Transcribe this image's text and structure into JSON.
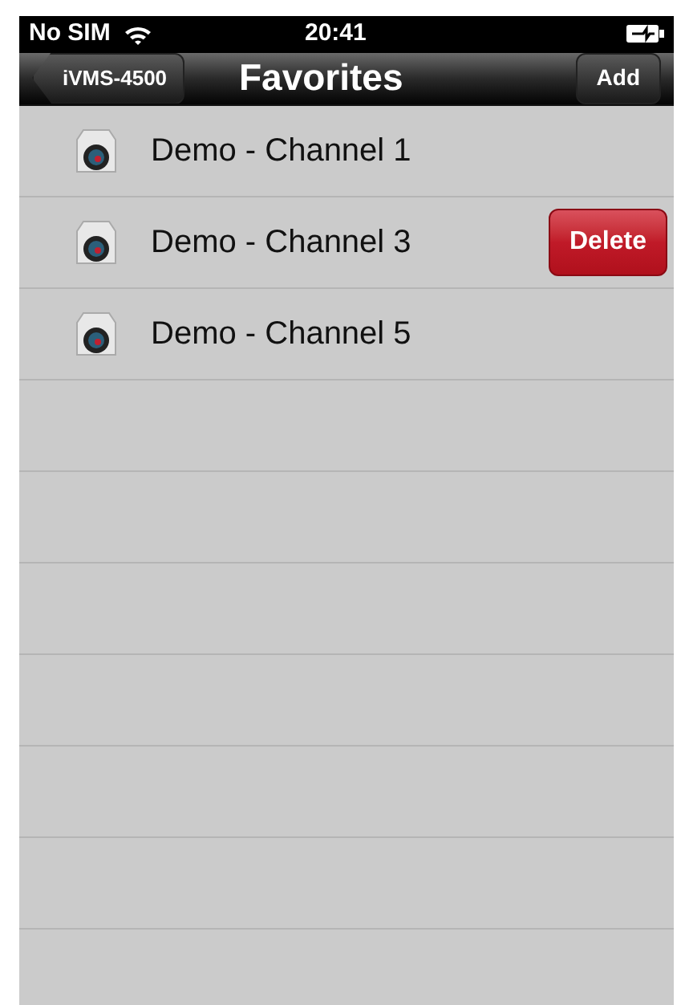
{
  "status_bar": {
    "carrier": "No SIM",
    "time": "20:41"
  },
  "nav_bar": {
    "back_button": "iVMS-4500",
    "title": "Favorites",
    "action_button": "Add"
  },
  "favorites": [
    {
      "label": "Demo - Channel 1"
    },
    {
      "label": "Demo - Channel 3",
      "delete_button": "Delete"
    },
    {
      "label": "Demo - Channel 5"
    }
  ]
}
